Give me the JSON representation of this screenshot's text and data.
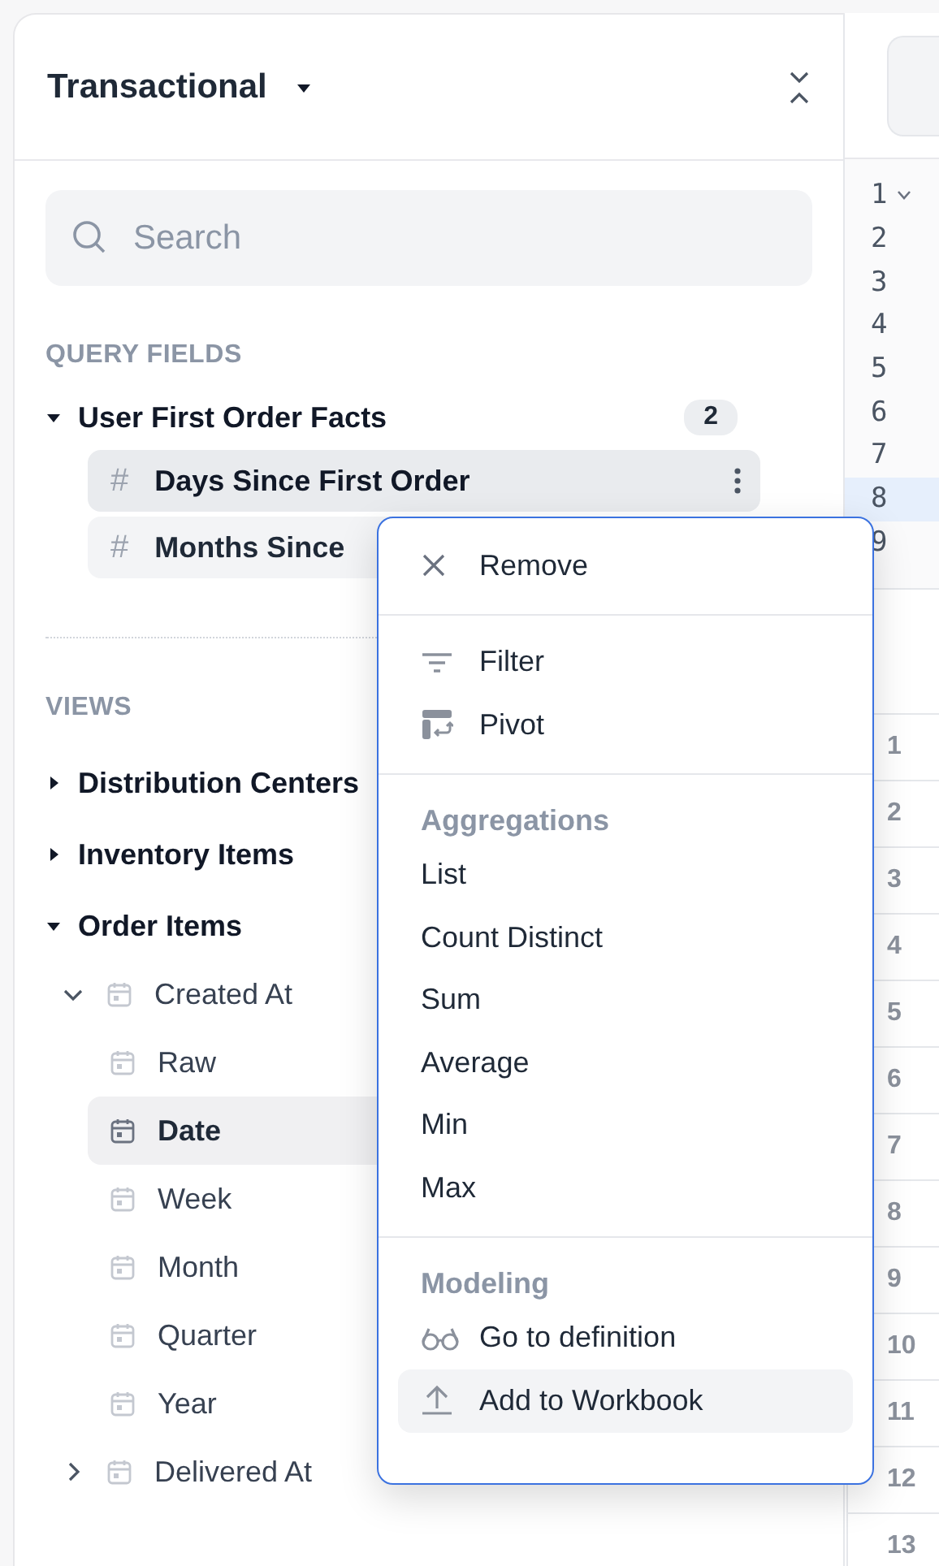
{
  "panel": {
    "title": "Transactional"
  },
  "search": {
    "placeholder": "Search"
  },
  "query_fields": {
    "heading": "QUERY FIELDS",
    "groups": [
      {
        "label": "User First Order Facts",
        "count": "2",
        "expanded": true,
        "children": [
          {
            "label": "Days Since First Order",
            "symbol": "#",
            "menu_open": true
          },
          {
            "label": "Months Since",
            "symbol": "#",
            "menu_open": false
          }
        ]
      }
    ]
  },
  "views": {
    "heading": "VIEWS",
    "items": [
      {
        "label": "Distribution Centers",
        "kind": "view",
        "expanded": false
      },
      {
        "label": "Inventory Items",
        "kind": "view",
        "expanded": false
      },
      {
        "label": "Order Items",
        "kind": "view",
        "expanded": true,
        "children": [
          {
            "label": "Created At",
            "kind": "date_group",
            "expanded": true,
            "children": [
              {
                "label": "Raw",
                "kind": "date",
                "selected": false
              },
              {
                "label": "Date",
                "kind": "date",
                "selected": true
              },
              {
                "label": "Week",
                "kind": "date",
                "selected": false
              },
              {
                "label": "Month",
                "kind": "date",
                "selected": false
              },
              {
                "label": "Quarter",
                "kind": "date",
                "selected": false
              },
              {
                "label": "Year",
                "kind": "date",
                "selected": false
              }
            ]
          },
          {
            "label": "Delivered At",
            "kind": "date_group",
            "expanded": false
          }
        ]
      }
    ]
  },
  "editor": {
    "lines": [
      {
        "number": "1",
        "foldable": true,
        "selected": false
      },
      {
        "number": "2",
        "foldable": false,
        "selected": false
      },
      {
        "number": "3",
        "foldable": false,
        "selected": false
      },
      {
        "number": "4",
        "foldable": false,
        "selected": false
      },
      {
        "number": "5",
        "foldable": false,
        "selected": false
      },
      {
        "number": "6",
        "foldable": false,
        "selected": false
      },
      {
        "number": "7",
        "foldable": false,
        "selected": false
      },
      {
        "number": "8",
        "foldable": false,
        "selected": true
      },
      {
        "number": "9",
        "foldable": false,
        "selected": false
      }
    ]
  },
  "results": {
    "row_numbers": [
      "1",
      "2",
      "3",
      "4",
      "5",
      "6",
      "7",
      "8",
      "9",
      "10",
      "11",
      "12",
      "13"
    ]
  },
  "context_menu": {
    "sections": [
      {
        "items": [
          {
            "label": "Remove",
            "selected": false
          }
        ]
      },
      {
        "items": [
          {
            "label": "Filter",
            "selected": false
          },
          {
            "label": "Pivot",
            "selected": false
          }
        ]
      },
      {
        "heading": "Aggregations",
        "items": [
          {
            "label": "List",
            "selected": false
          },
          {
            "label": "Count Distinct",
            "selected": false
          },
          {
            "label": "Sum",
            "selected": false
          },
          {
            "label": "Average",
            "selected": false
          },
          {
            "label": "Min",
            "selected": false
          },
          {
            "label": "Max",
            "selected": false
          }
        ]
      },
      {
        "heading": "Modeling",
        "items": [
          {
            "label": "Go to definition",
            "selected": false
          },
          {
            "label": "Add to Workbook",
            "selected": true
          }
        ]
      }
    ]
  }
}
